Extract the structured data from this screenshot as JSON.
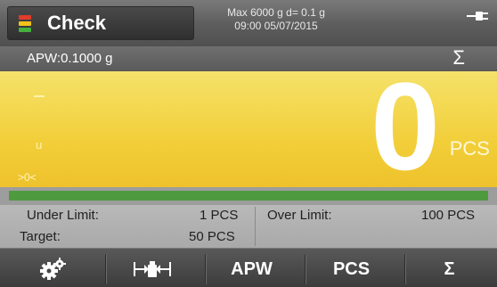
{
  "header": {
    "mode_label": "Check",
    "capacity": "Max 6000 g  d= 0.1 g",
    "datetime": "09:00   05/07/2015",
    "mode_icon": "traffic-light-icon",
    "power_icon": "plug-icon"
  },
  "apw_bar": {
    "text": "APW:0.1000 g",
    "sigma_icon": "Σ"
  },
  "display": {
    "value": "0",
    "unit": "PCS",
    "zero_indicator": ">0<",
    "under_indicator": "u",
    "background_color": "#f2cf3a"
  },
  "progress": {
    "fraction": 1.0,
    "color": "#4e9a3f"
  },
  "limits": {
    "under_label": "Under Limit:",
    "under_value": "1 PCS",
    "target_label": "Target:",
    "target_value": "50 PCS",
    "over_label": "Over Limit:",
    "over_value": "100 PCS"
  },
  "softkeys": [
    {
      "name": "settings-gear-icon",
      "label": ""
    },
    {
      "name": "tare-icon",
      "label": ""
    },
    {
      "name": "apw",
      "label": "APW"
    },
    {
      "name": "pcs",
      "label": "PCS"
    },
    {
      "name": "sigma",
      "label": "Σ"
    }
  ]
}
